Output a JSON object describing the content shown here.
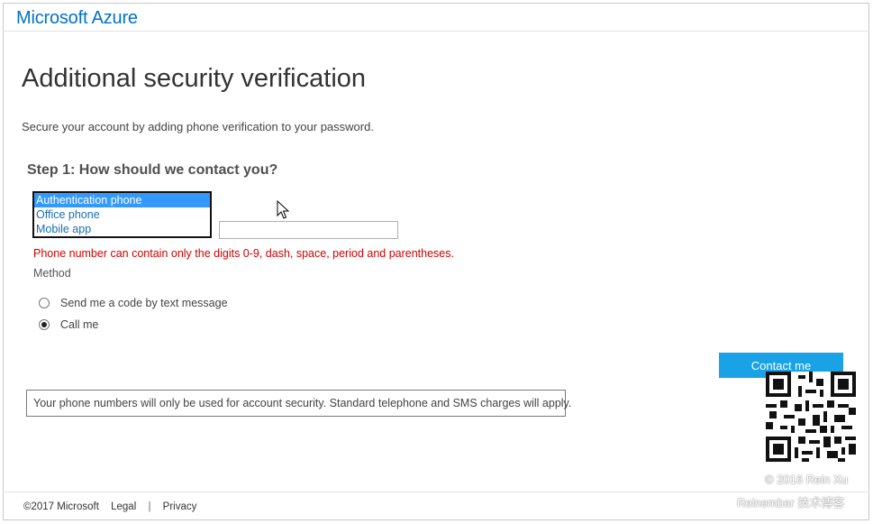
{
  "header": {
    "brand": "Microsoft Azure"
  },
  "page": {
    "title": "Additional security verification",
    "subtitle": "Secure your account by adding phone verification to your password."
  },
  "step1": {
    "heading": "Step 1: How should we contact you?",
    "contact_options": [
      "Authentication phone",
      "Office phone",
      "Mobile app"
    ],
    "selected_option": "Authentication phone",
    "phone_value": "",
    "error": "Phone number can contain only the digits 0-9, dash, space, period and parentheses.",
    "method_label": "Method",
    "methods": [
      {
        "label": "Send me a code by text message",
        "checked": false
      },
      {
        "label": "Call me",
        "checked": true
      }
    ],
    "contact_button": "Contact me"
  },
  "notice": "Your phone numbers will only be used for account security. Standard telephone and SMS charges will apply.",
  "footer": {
    "copyright": "©2017 Microsoft",
    "legal": "Legal",
    "separator": "|",
    "privacy": "Privacy"
  },
  "watermark": {
    "line1": "© 2016 Rein Xu",
    "line2": "Reinember 技术博客"
  },
  "colors": {
    "brand": "#0072c6",
    "button": "#19a2e6",
    "error": "#d40000",
    "selected": "#3399ff"
  }
}
